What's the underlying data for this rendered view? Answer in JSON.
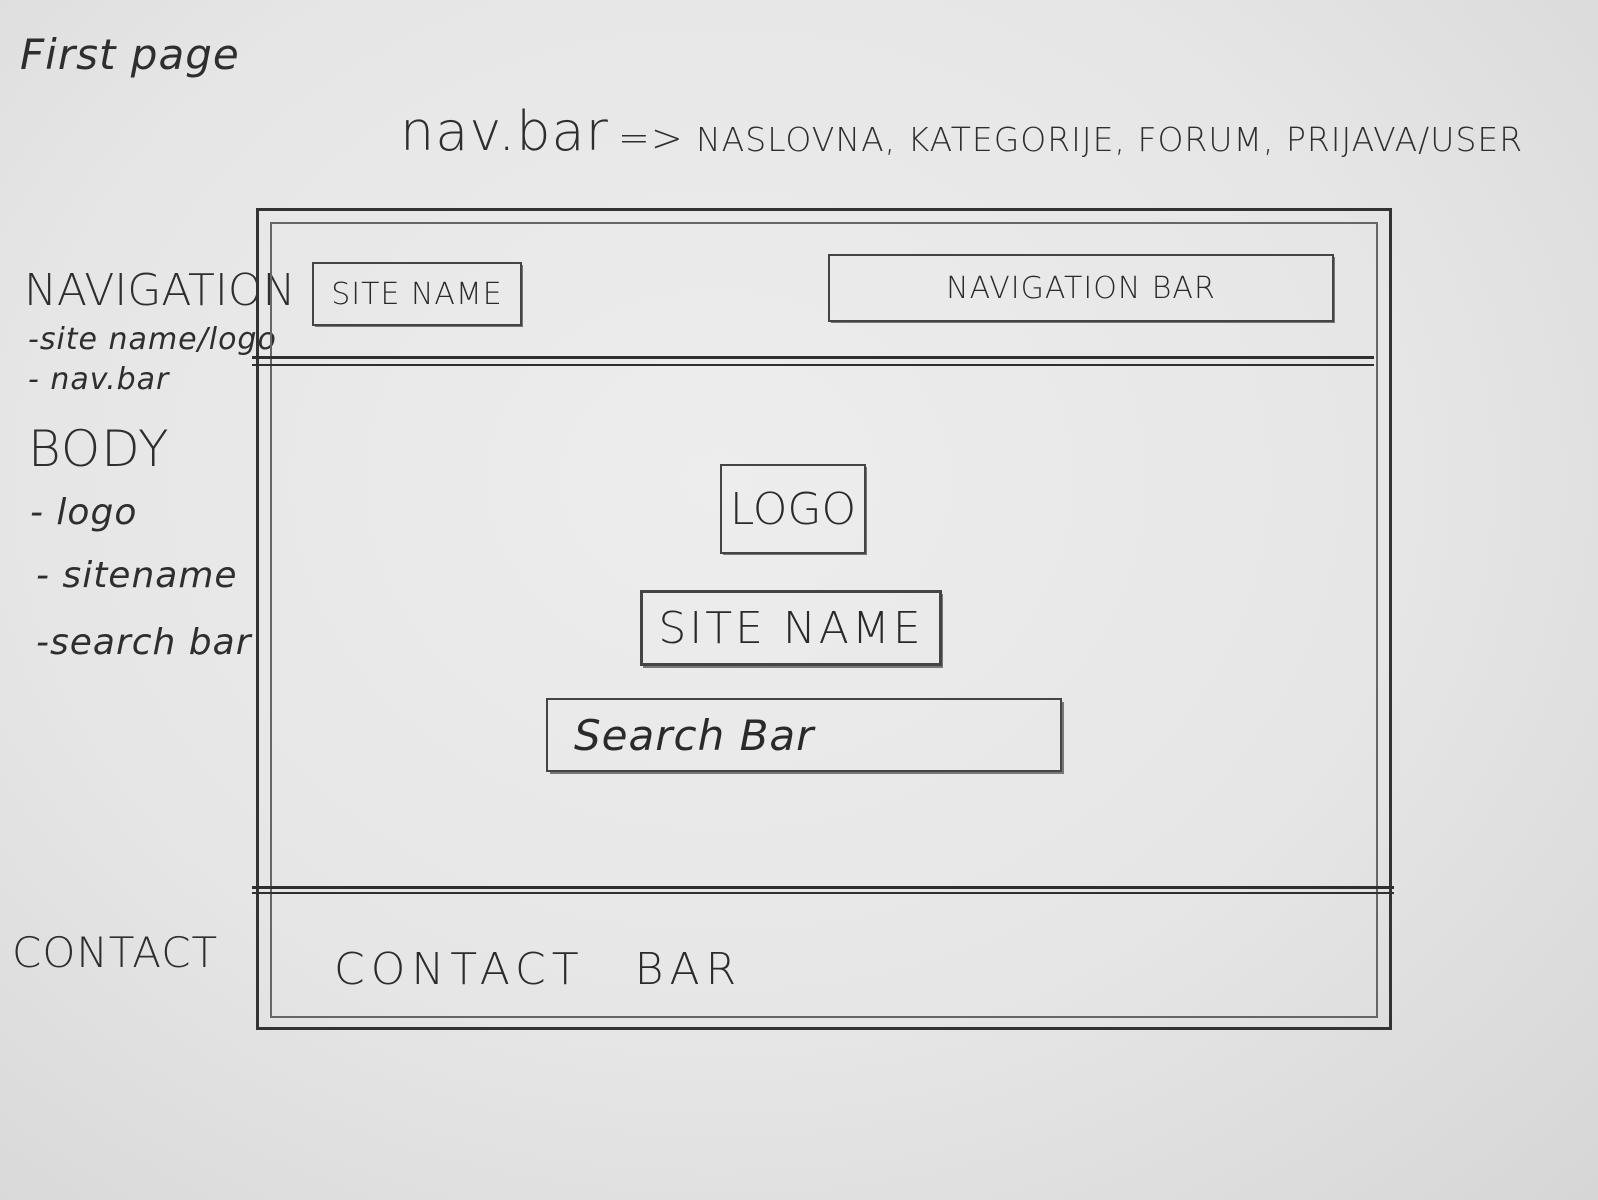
{
  "page_title": "First page",
  "navbar_note": {
    "label": "nav.bar",
    "arrow": "=>",
    "items": "NASLOVNA, KATEGORIJE, FORUM, PRIJAVA/USER"
  },
  "side_notes": {
    "navigation": {
      "heading": "NAVIGATION",
      "items": [
        "-site name/logo",
        "- nav.bar"
      ]
    },
    "body": {
      "heading": "BODY",
      "items": [
        "- logo",
        "- sitename",
        "-search bar"
      ]
    },
    "contact": {
      "heading": "CONTACT"
    }
  },
  "wireframe": {
    "header": {
      "site_name": "SITE NAME",
      "navigation_bar": "NAVIGATION BAR"
    },
    "body": {
      "logo": "LOGO",
      "site_name": "SITE NAME",
      "search_bar": "Search Bar"
    },
    "footer": {
      "contact_bar_word1": "CONTACT",
      "contact_bar_word2": "BAR"
    }
  }
}
